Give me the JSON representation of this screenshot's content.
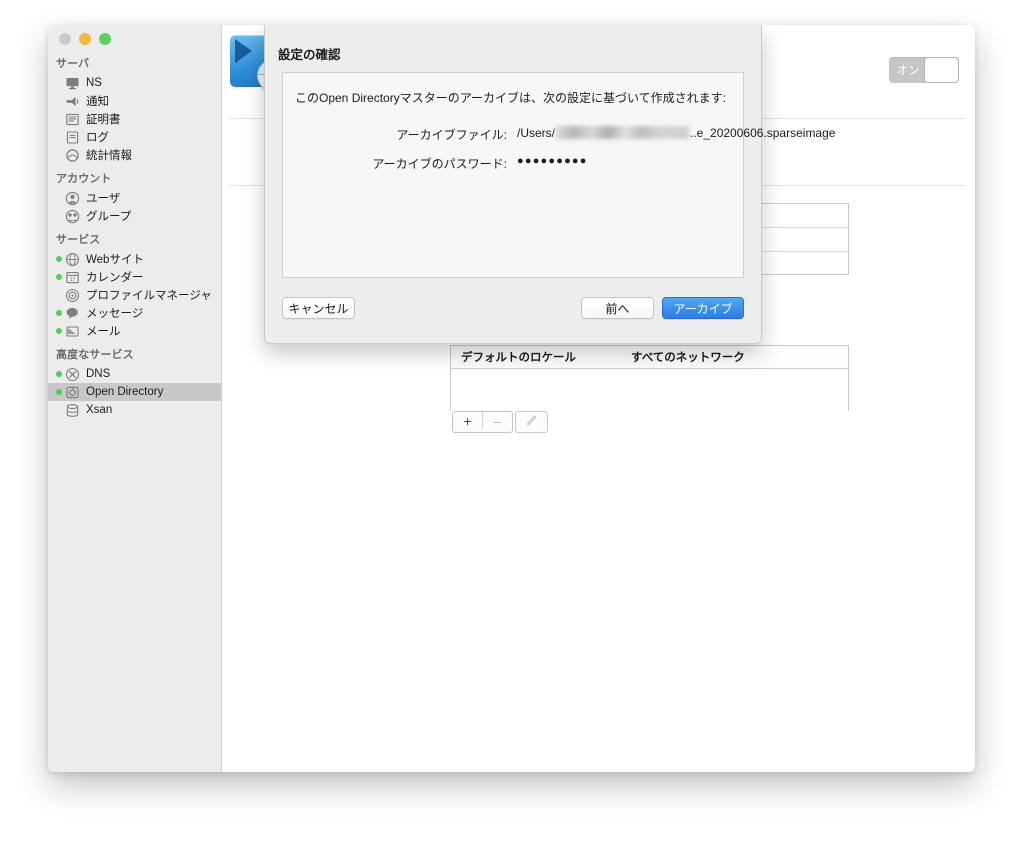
{
  "window": {
    "traffic_lights": [
      "close",
      "minimize",
      "zoom"
    ]
  },
  "sidebar": {
    "sections": [
      {
        "header": "サーバ",
        "items": [
          {
            "label": "NS",
            "icon": "display-icon",
            "status": "none"
          },
          {
            "label": "通知",
            "icon": "megaphone-icon",
            "status": "none"
          },
          {
            "label": "証明書",
            "icon": "certificate-icon",
            "status": "none"
          },
          {
            "label": "ログ",
            "icon": "log-icon",
            "status": "none"
          },
          {
            "label": "統計情報",
            "icon": "stats-icon",
            "status": "none"
          }
        ]
      },
      {
        "header": "アカウント",
        "items": [
          {
            "label": "ユーザ",
            "icon": "user-icon",
            "status": "none"
          },
          {
            "label": "グループ",
            "icon": "groups-icon",
            "status": "none"
          }
        ]
      },
      {
        "header": "サービス",
        "items": [
          {
            "label": "Webサイト",
            "icon": "globe-icon",
            "status": "on"
          },
          {
            "label": "カレンダー",
            "icon": "calendar-icon",
            "status": "on"
          },
          {
            "label": "プロファイルマネージャ",
            "icon": "profile-icon",
            "status": "none"
          },
          {
            "label": "メッセージ",
            "icon": "message-icon",
            "status": "on"
          },
          {
            "label": "メール",
            "icon": "mail-icon",
            "status": "on"
          }
        ]
      },
      {
        "header": "高度なサービス",
        "items": [
          {
            "label": "DNS",
            "icon": "dns-icon",
            "status": "on"
          },
          {
            "label": "Open Directory",
            "icon": "open-directory-icon",
            "status": "on",
            "selected": true
          },
          {
            "label": "Xsan",
            "icon": "xsan-icon",
            "status": "none"
          }
        ]
      }
    ],
    "selected_color": "#c8c8c8",
    "status_on_color": "#4cd24c"
  },
  "content": {
    "service_icon": "open-directory-icon",
    "toggle": {
      "label": "オン",
      "state": "on",
      "enabled": false
    },
    "locales_table": {
      "columns": [
        "デフォルトのロケール",
        "すべてのネットワーク"
      ],
      "rows": []
    },
    "toolbar": {
      "add_label": "+",
      "remove_label": "–",
      "edit_label": "pencil-icon"
    }
  },
  "sheet": {
    "title": "設定の確認",
    "intro": "このOpen Directoryマスターのアーカイブは、次の設定に基づいて作成されます:",
    "fields": [
      {
        "label": "アーカイブファイル:",
        "value_prefix": "/Users/",
        "value_redacted": true,
        "value_suffix": "..e_20200606.sparseimage"
      },
      {
        "label": "アーカイブのパスワード:",
        "value": "●●●●●●●●●"
      }
    ],
    "buttons": {
      "cancel": "キャンセル",
      "back": "前へ",
      "archive": "アーカイブ"
    },
    "primary_color": "#2b7de4"
  }
}
